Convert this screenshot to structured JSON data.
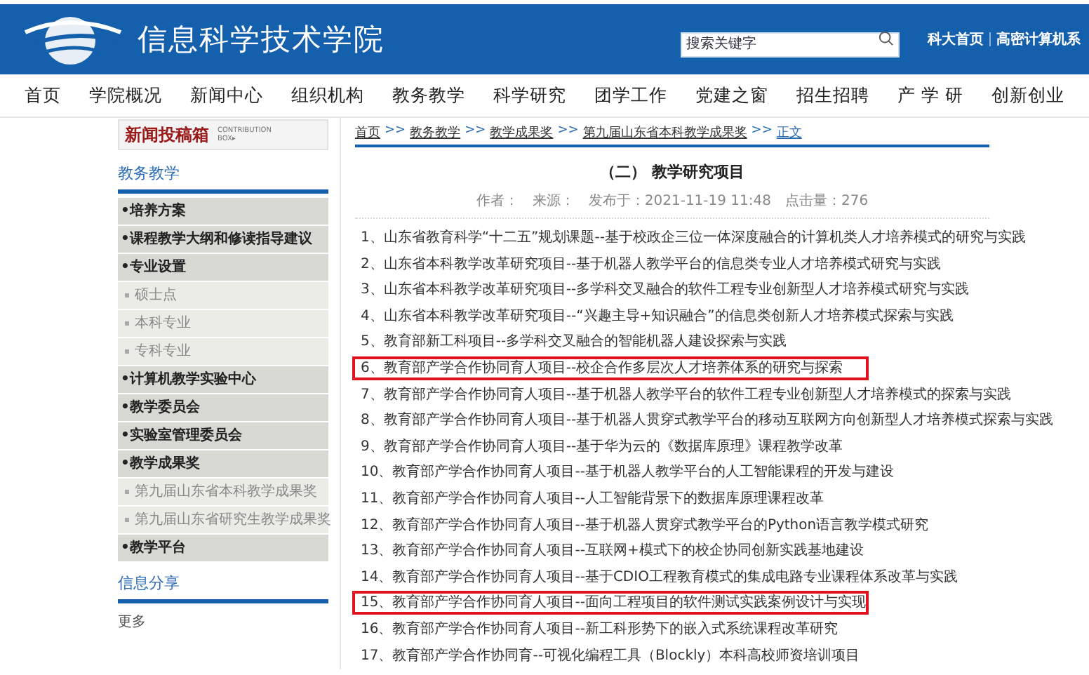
{
  "header": {
    "site_title": "信息科学技术学院",
    "search": {
      "placeholder": "搜索关键字"
    },
    "links": [
      "科大首页",
      "高密计算机系"
    ]
  },
  "nav": [
    "首页",
    "学院概况",
    "新闻中心",
    "组织机构",
    "教务教学",
    "科学研究",
    "团学工作",
    "党建之窗",
    "招生招聘",
    "产 学 研",
    "创新创业"
  ],
  "sidebar": {
    "banner": {
      "title": "新闻投稿箱",
      "subtitle": "CONTRIBUTION BOX▸"
    },
    "section_title": "教务教学",
    "menu": [
      {
        "kind": "main",
        "label": "•培养方案"
      },
      {
        "kind": "main",
        "label": "•课程教学大纲和修读指导建议"
      },
      {
        "kind": "main",
        "label": "•专业设置"
      },
      {
        "kind": "sub",
        "label": "硕士点"
      },
      {
        "kind": "sub",
        "label": "本科专业"
      },
      {
        "kind": "sub",
        "label": "专科专业"
      },
      {
        "kind": "main",
        "label": "•计算机教学实验中心"
      },
      {
        "kind": "main",
        "label": "•教学委员会"
      },
      {
        "kind": "main",
        "label": "•实验室管理委员会"
      },
      {
        "kind": "main",
        "label": "•教学成果奖"
      },
      {
        "kind": "sub",
        "label": "第九届山东省本科教学成果奖"
      },
      {
        "kind": "sub",
        "label": "第九届山东省研究生教学成果奖"
      },
      {
        "kind": "main",
        "label": "•教学平台"
      }
    ],
    "share_title": "信息分享",
    "more": "更多"
  },
  "article": {
    "breadcrumb": [
      "首页",
      "教务教学",
      "教学成果奖",
      "第九届山东省本科教学成果奖",
      "正文"
    ],
    "separator": ">>",
    "title": "（二） 教学研究项目",
    "meta": [
      "作者：",
      "来源：",
      "发布于：2021-11-19 11:48",
      "点击量：276"
    ],
    "items": [
      {
        "text": "1、山东省教育科学“十二五”规划课题--基于校政企三位一体深度融合的计算机类人才培养模式的研究与实践",
        "highlighted": false
      },
      {
        "text": "2、山东省本科教学改革研究项目--基于机器人教学平台的信息类专业人才培养模式研究与实践",
        "highlighted": false
      },
      {
        "text": "3、山东省本科教学改革研究项目--多学科交叉融合的软件工程专业创新型人才培养模式研究与实践",
        "highlighted": false
      },
      {
        "text": "4、山东省本科教学改革研究项目--“兴趣主导+知识融合”的信息类创新人才培养模式探索与实践",
        "highlighted": false
      },
      {
        "text": "5、教育部新工科项目--多学科交叉融合的智能机器人建设探索与实践",
        "highlighted": false
      },
      {
        "text": "6、教育部产学合作协同育人项目--校企合作多层次人才培养体系的研究与探索",
        "highlighted": true
      },
      {
        "text": "7、教育部产学合作协同育人项目--基于机器人教学平台的软件工程专业创新型人才培养模式的探索与实践",
        "highlighted": false
      },
      {
        "text": "8、教育部产学合作协同育人项目--基于机器人贯穿式教学平台的移动互联网方向创新型人才培养模式探索与实践",
        "highlighted": false
      },
      {
        "text": "9、教育部产学合作协同育人项目--基于华为云的《数据库原理》课程教学改革",
        "highlighted": false
      },
      {
        "text": "10、教育部产学合作协同育人项目--基于机器人教学平台的人工智能课程的开发与建设",
        "highlighted": false
      },
      {
        "text": "11、教育部产学合作协同育人项目--人工智能背景下的数据库原理课程改革",
        "highlighted": false
      },
      {
        "text": "12、教育部产学合作协同育人项目--基于机器人贯穿式教学平台的Python语言教学模式研究",
        "highlighted": false
      },
      {
        "text": "13、教育部产学合作协同育人项目--互联网+模式下的校企协同创新实践基地建设",
        "highlighted": false
      },
      {
        "text": "14、教育部产学合作协同育人项目--基于CDIO工程教育模式的集成电路专业课程体系改革与实践",
        "highlighted": false
      },
      {
        "text": "15、教育部产学合作协同育人项目--面向工程项目的软件测试实践案例设计与实现",
        "highlighted": true
      },
      {
        "text": "16、教育部产学合作协同育人项目--新工科形势下的嵌入式系统课程改革研究",
        "highlighted": false
      },
      {
        "text": "17、教育部产学合作协同育--可视化编程工具（Blockly）本科高校师资培训项目",
        "highlighted": false
      }
    ]
  }
}
